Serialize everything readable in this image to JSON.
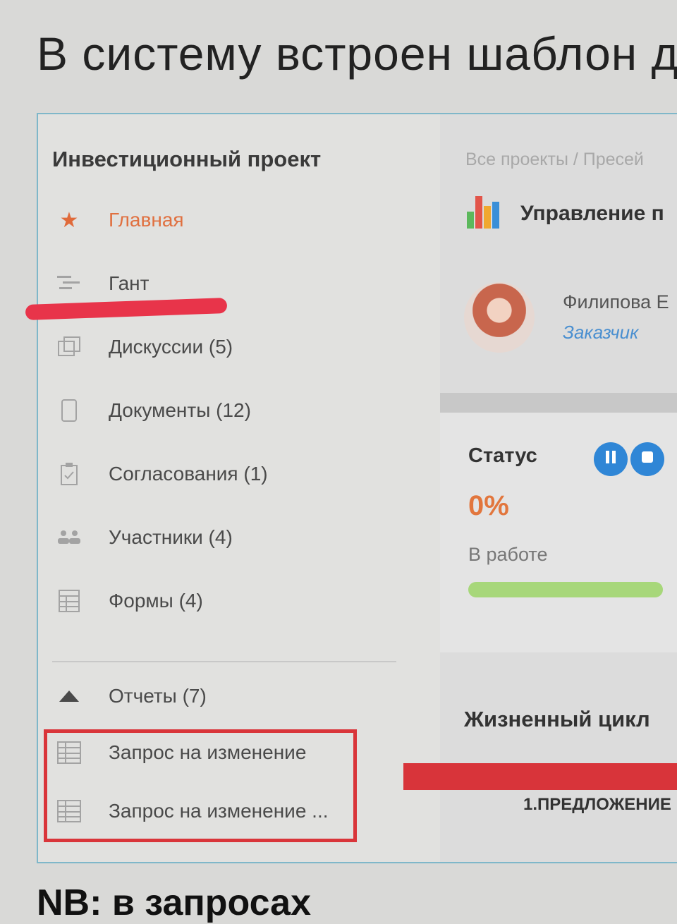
{
  "slide": {
    "heading": "В систему встроен шаблон до",
    "footer_note": "NB: в запросах"
  },
  "sidebar": {
    "title": "Инвестиционный проект",
    "items": [
      {
        "label": "Главная",
        "icon": "star-icon",
        "active": true
      },
      {
        "label": "Гант",
        "icon": "gantt-icon"
      },
      {
        "label": "Дискуссии (5)",
        "icon": "discussions-icon"
      },
      {
        "label": "Документы (12)",
        "icon": "document-icon"
      },
      {
        "label": "Согласования (1)",
        "icon": "approval-icon"
      },
      {
        "label": "Участники (4)",
        "icon": "participants-icon"
      },
      {
        "label": "Формы (4)",
        "icon": "forms-icon"
      }
    ],
    "reports": {
      "label": "Отчеты (7)",
      "icon": "triangle-up-icon"
    },
    "report_items": [
      {
        "label": "Запрос на изменение",
        "icon": "form-grid-icon"
      },
      {
        "label": "Запрос на изменение ...",
        "icon": "form-grid-icon"
      }
    ]
  },
  "main": {
    "breadcrumb": "Все проекты / Пресей",
    "project_title": "Управление п",
    "project_icon": "bar-chart-icon",
    "customer": {
      "name": "Филипова Е",
      "role": "Заказчик"
    },
    "status": {
      "title": "Статус",
      "percent": "0%",
      "progress": 0,
      "state": "В работе",
      "buttons": [
        "pause-icon",
        "stop-icon"
      ]
    },
    "lifecycle": {
      "title": "Жизненный цикл",
      "stage": "1.ПРЕДЛОЖЕНИЕ"
    }
  },
  "colors": {
    "accent_orange": "#e2763d",
    "link_blue": "#4a8fd0",
    "button_blue": "#2f86d6",
    "progress_green": "#a7d77a",
    "annotation_red": "#d9353a",
    "frame_border": "#7fb7c9"
  }
}
